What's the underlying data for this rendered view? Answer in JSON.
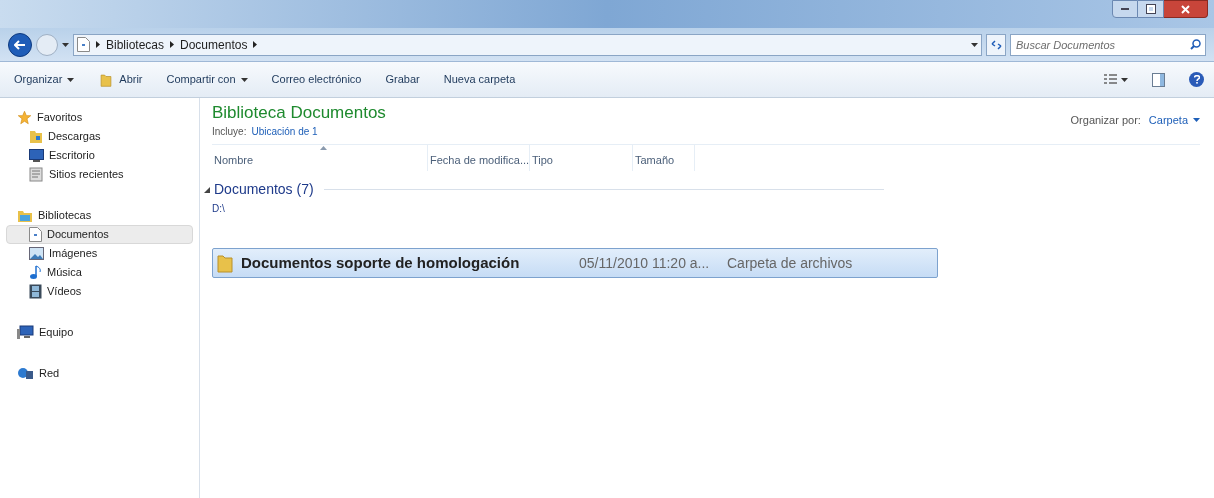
{
  "address_bar": {
    "breadcrumbs": [
      "Bibliotecas",
      "Documentos"
    ]
  },
  "search": {
    "placeholder": "Buscar Documentos"
  },
  "toolbar": [
    {
      "label": "Organizar",
      "dropdown": true,
      "kind": "text"
    },
    {
      "label": "Abrir",
      "dropdown": false,
      "kind": "open"
    },
    {
      "label": "Compartir con",
      "dropdown": true,
      "kind": "text"
    },
    {
      "label": "Correo electrónico",
      "dropdown": false,
      "kind": "text"
    },
    {
      "label": "Grabar",
      "dropdown": false,
      "kind": "text"
    },
    {
      "label": "Nueva carpeta",
      "dropdown": false,
      "kind": "text"
    }
  ],
  "sidebar": [
    {
      "label": "Favoritos",
      "kind": "star",
      "selected": false,
      "children": [
        {
          "label": "Descargas",
          "kind": "download",
          "selected": false
        },
        {
          "label": "Escritorio",
          "kind": "desktop",
          "selected": false
        },
        {
          "label": "Sitios recientes",
          "kind": "recent",
          "selected": false
        }
      ]
    },
    {
      "label": "Bibliotecas",
      "kind": "library",
      "selected": false,
      "children": [
        {
          "label": "Documentos",
          "kind": "document",
          "selected": true
        },
        {
          "label": "Imágenes",
          "kind": "image",
          "selected": false
        },
        {
          "label": "Música",
          "kind": "music",
          "selected": false
        },
        {
          "label": "Vídeos",
          "kind": "video",
          "selected": false
        }
      ]
    },
    {
      "label": "Equipo",
      "kind": "computer",
      "selected": false
    },
    {
      "label": "Red",
      "kind": "network",
      "selected": false
    }
  ],
  "library": {
    "title": "Biblioteca Documentos",
    "includes_label": "Incluye:",
    "includes_link": "Ubicación de 1",
    "arrange_label": "Organizar por:",
    "arrange_value": "Carpeta"
  },
  "columns": [
    {
      "label": "Nombre",
      "sorted": true
    },
    {
      "label": "Fecha de modifica...",
      "sorted": false
    },
    {
      "label": "Tipo",
      "sorted": false
    },
    {
      "label": "Tamaño",
      "sorted": false
    }
  ],
  "group": {
    "label": "Documentos (7)",
    "path": "D:\\",
    "expanded": true
  },
  "rows": [
    {
      "name": "Documentos soporte de homologación",
      "date": "05/11/2010 11:20 a...",
      "type": "Carpeta de archivos",
      "selected": true
    }
  ]
}
